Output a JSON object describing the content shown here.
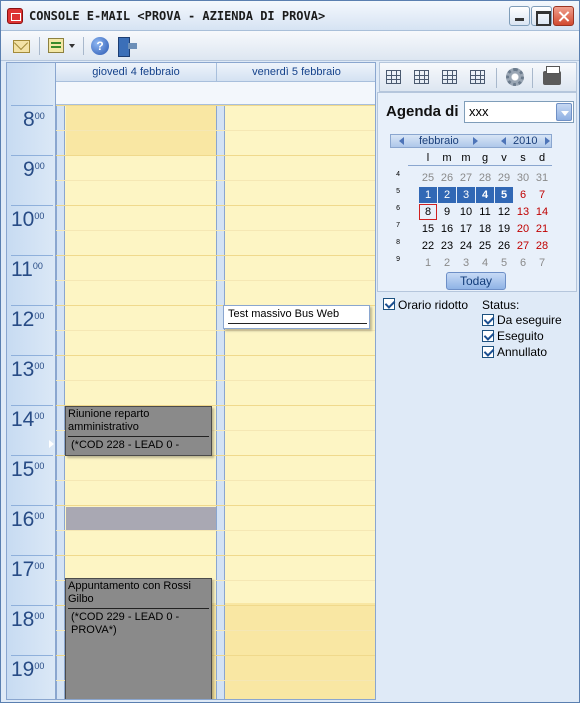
{
  "window": {
    "title": "CONSOLE E-MAIL <PROVA - AZIENDA DI PROVA>"
  },
  "toolbar": {
    "icons": [
      "envelope-icon",
      "task-list-icon",
      "help-icon",
      "exit-icon"
    ]
  },
  "calendar": {
    "days": [
      "giovedì 4 febbraio",
      "venerdì 5 febbraio"
    ],
    "hours": [
      {
        "h": "8",
        "m": "00"
      },
      {
        "h": "9",
        "m": "00"
      },
      {
        "h": "10",
        "m": "00"
      },
      {
        "h": "11",
        "m": "00"
      },
      {
        "h": "12",
        "m": "00"
      },
      {
        "h": "13",
        "m": "00"
      },
      {
        "h": "14",
        "m": "00"
      },
      {
        "h": "15",
        "m": "00"
      },
      {
        "h": "16",
        "m": "00"
      },
      {
        "h": "17",
        "m": "00"
      },
      {
        "h": "18",
        "m": "00"
      },
      {
        "h": "19",
        "m": "00"
      }
    ],
    "appointments": [
      {
        "title": "Riunione reparto amministrativo",
        "detail": "(*COD 228 - LEAD 0 -",
        "day": 0,
        "start": "14:00",
        "end": "15:00"
      },
      {
        "title": "Appuntamento con Rossi Gilbo",
        "detail": "(*COD 229 - LEAD 0 - PROVA*)",
        "day": 0,
        "start": "17:00",
        "end": "19:30"
      },
      {
        "title": "Test massivo Bus Web",
        "day": 1,
        "start": "12:00",
        "end": "12:30"
      }
    ]
  },
  "right_panel": {
    "agenda_label": "Agenda di",
    "agenda_value": "xxx",
    "minical": {
      "month": "febbraio",
      "year": "2010",
      "dow": [
        "l",
        "m",
        "m",
        "g",
        "v",
        "s",
        "d"
      ],
      "weeks": [
        {
          "wk": "4",
          "days": [
            "25",
            "26",
            "27",
            "28",
            "29",
            "30",
            "31"
          ]
        },
        {
          "wk": "5",
          "days": [
            "1",
            "2",
            "3",
            "4",
            "5",
            "6",
            "7"
          ]
        },
        {
          "wk": "6",
          "days": [
            "8",
            "9",
            "10",
            "11",
            "12",
            "13",
            "14"
          ]
        },
        {
          "wk": "7",
          "days": [
            "15",
            "16",
            "17",
            "18",
            "19",
            "20",
            "21"
          ]
        },
        {
          "wk": "8",
          "days": [
            "22",
            "23",
            "24",
            "25",
            "26",
            "27",
            "28"
          ]
        },
        {
          "wk": "9",
          "days": [
            "1",
            "2",
            "3",
            "4",
            "5",
            "6",
            "7"
          ]
        }
      ],
      "today_label": "Today"
    },
    "orario_ridotto": "Orario ridotto",
    "status_label": "Status:",
    "status_options": [
      "Da eseguire",
      "Eseguito",
      "Annullato"
    ]
  }
}
